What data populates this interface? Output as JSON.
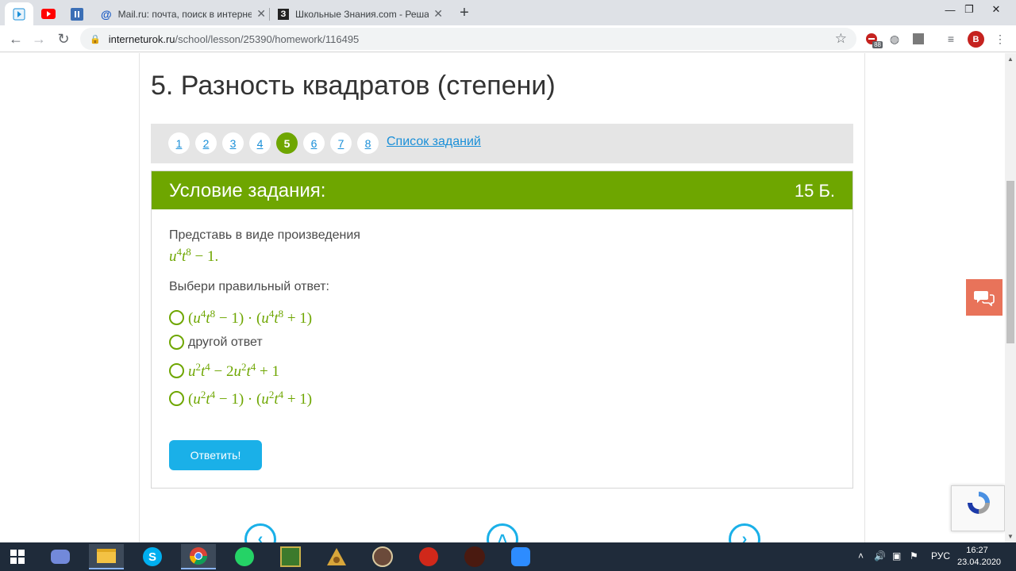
{
  "browser": {
    "tabs": [
      {
        "title": "Mail.ru: почта, поиск в интерне"
      },
      {
        "title": "Школьные Знания.com - Решае"
      }
    ],
    "url_host": "interneturok.ru",
    "url_path": "/school/lesson/25390/homework/116495",
    "extension_badge": "88",
    "profile_initial": "B"
  },
  "page": {
    "lesson_title": "5. Разность квадратов (степени)",
    "task_numbers": [
      "1",
      "2",
      "3",
      "4",
      "5",
      "6",
      "7",
      "8"
    ],
    "current_task": "5",
    "task_list_link": "Список заданий",
    "task_header": "Условие задания:",
    "points": "15 Б.",
    "prompt": "Представь в виде произведения",
    "choose_label": "Выбери правильный ответ:",
    "options": [
      {
        "text": "(u4t8 − 1) · (u4t8 + 1)"
      },
      {
        "text": "другой ответ"
      },
      {
        "text": "u2t4 − 2u2t4 + 1"
      },
      {
        "text": "(u2t4 − 1) · (u2t4 + 1)"
      }
    ],
    "submit_label": "Ответить!"
  },
  "taskbar": {
    "language": "РУС",
    "time": "16:27",
    "date": "23.04.2020"
  },
  "colors": {
    "accent_green": "#6ea600",
    "link_blue": "#1a8fd8",
    "button_blue": "#1ab0e8",
    "chat_orange": "#e8735a"
  }
}
